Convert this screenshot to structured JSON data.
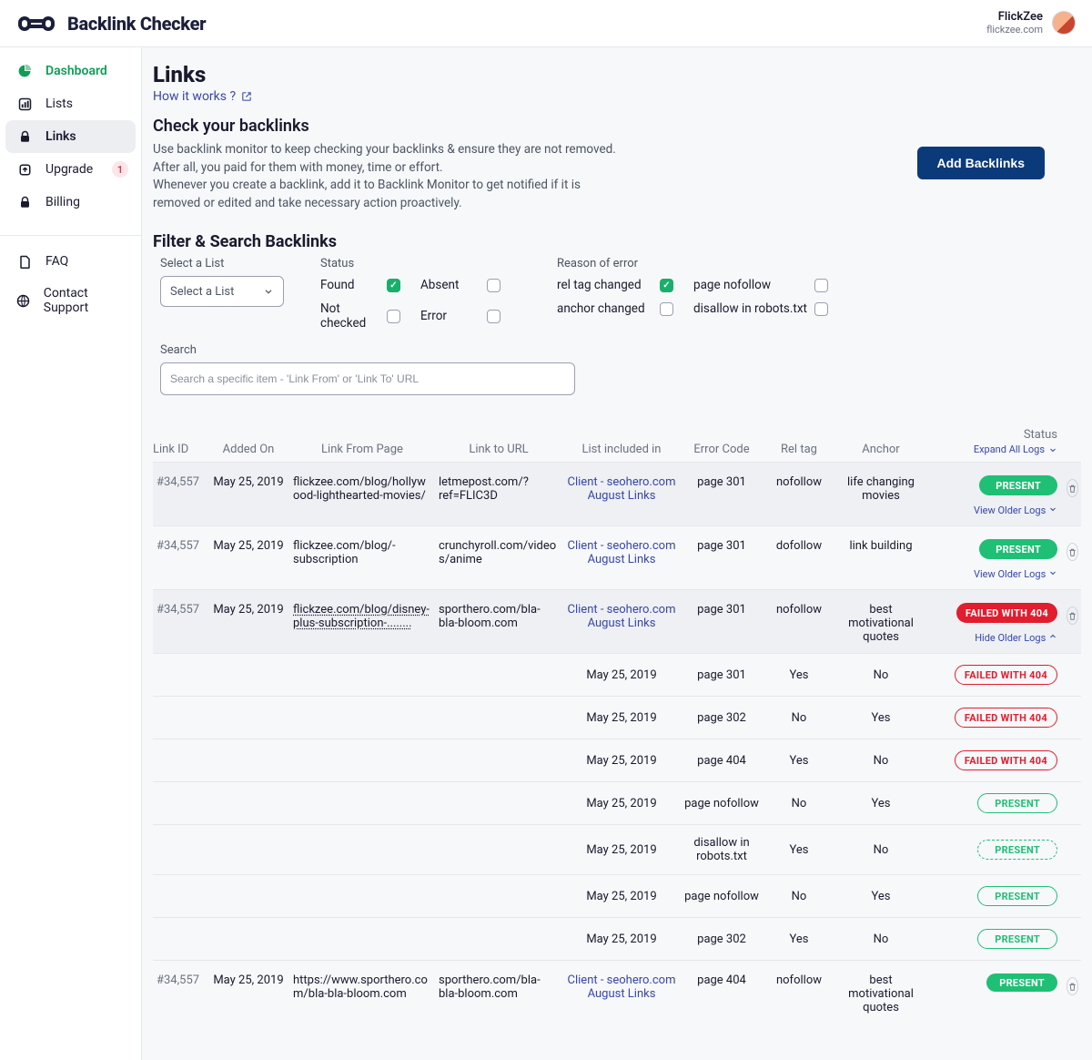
{
  "brand": {
    "name": "Backlink Checker"
  },
  "user": {
    "name": "FlickZee",
    "domain": "flickzee.com"
  },
  "sidebar": {
    "items": [
      {
        "label": "Dashboard"
      },
      {
        "label": "Lists"
      },
      {
        "label": "Links"
      },
      {
        "label": "Upgrade",
        "badge": "1"
      },
      {
        "label": "Billing"
      }
    ],
    "items2": [
      {
        "label": "FAQ"
      },
      {
        "label": "Contact Support"
      }
    ]
  },
  "page": {
    "title": "Links",
    "how_link": "How it works ?",
    "subtitle": "Check your backlinks",
    "intro_l1": "Use backlink monitor to keep checking your backlinks & ensure they are not removed.",
    "intro_l2": "After all, you paid for them with money, time or effort.",
    "intro_l3": "Whenever you create a backlink, add it to Backlink Monitor to get notified if it is removed or edited and take necessary action proactively.",
    "add_btn": "Add Backlinks"
  },
  "filters": {
    "title": "Filter & Search Backlinks",
    "select_list_label": "Select a List",
    "select_list_value": "Select a List",
    "status_label": "Status",
    "status_found": "Found",
    "status_absent": "Absent",
    "status_notchecked": "Not checked",
    "status_error": "Error",
    "reason_label": "Reason of error",
    "reason_rel": "rel tag changed",
    "reason_anchor": "anchor changed",
    "reason_nofollow": "page nofollow",
    "reason_robots": "disallow in robots.txt",
    "search_label": "Search",
    "search_placeholder": "Search a specific item - 'Link From' or 'Link To' URL"
  },
  "table": {
    "headers": {
      "link_id": "Link ID",
      "added_on": "Added On",
      "link_from": "Link From Page",
      "link_to": "Link to URL",
      "list": "List included in",
      "error_code": "Error Code",
      "rel": "Rel tag",
      "anchor": "Anchor",
      "status": "Status",
      "expand_all": "Expand All Logs"
    },
    "view_older": "View Older Logs",
    "hide_older": "Hide  Older Logs",
    "rows": [
      {
        "id": "#34,557",
        "added": "May 25, 2019",
        "from": "flickzee.com/blog/hollywood-lighthearted-movies/",
        "to": "letmepost.com/?ref=FLIC3D",
        "list1": "Client - seohero.com",
        "list2": "August Links",
        "error": "page 301",
        "rel": "nofollow",
        "anchor": "life changing movies",
        "status": "PRESENT",
        "status_style": "solid"
      },
      {
        "id": "#34,557",
        "added": "May 25, 2019",
        "from": "flickzee.com/blog/-subscription",
        "to": "crunchyroll.com/videos/anime",
        "list1": "Client - seohero.com",
        "list2": "August Links",
        "error": "page 301",
        "rel": "dofollow",
        "anchor": "link building",
        "status": "PRESENT",
        "status_style": "solid"
      },
      {
        "id": "#34,557",
        "added": "May 25, 2019",
        "from": "flickzee.com/blog/disney-plus-subscription-........",
        "to": "sporthero.com/bla-bla-bloom.com",
        "list1": "Client - seohero.com",
        "list2": "August Links",
        "error": "page 301",
        "rel": "nofollow",
        "anchor": "best motivational quotes",
        "status": "FAILED WITH 404",
        "status_style": "fail-solid",
        "from_underlined": true,
        "expanded_logs": [
          {
            "date": "May 25, 2019",
            "error": "page 301",
            "rel": "Yes",
            "anchor": "No",
            "status": "FAILED WITH 404",
            "style": "fail-outline"
          },
          {
            "date": "May 25, 2019",
            "error": "page 302",
            "rel": "No",
            "anchor": "Yes",
            "status": "FAILED WITH 404",
            "style": "fail-outline"
          },
          {
            "date": "May 25, 2019",
            "error": "page 404",
            "rel": "Yes",
            "anchor": "No",
            "status": "FAILED WITH 404",
            "style": "fail-outline"
          },
          {
            "date": "May 25, 2019",
            "error": "page nofollow",
            "rel": "No",
            "anchor": "Yes",
            "status": "PRESENT",
            "style": "present-outline"
          },
          {
            "date": "May 25, 2019",
            "error": "disallow in robots.txt",
            "rel": "Yes",
            "anchor": "No",
            "status": "PRESENT",
            "style": "present-dashed"
          },
          {
            "date": "May 25, 2019",
            "error": "page nofollow",
            "rel": "No",
            "anchor": "Yes",
            "status": "PRESENT",
            "style": "present-outline"
          },
          {
            "date": "May 25, 2019",
            "error": "page 302",
            "rel": "Yes",
            "anchor": "No",
            "status": "PRESENT",
            "style": "present-outline"
          }
        ]
      },
      {
        "id": "#34,557",
        "added": "May 25, 2019",
        "from": "https://www.sporthero.com/bla-bla-bloom.com",
        "to": "sporthero.com/bla-bla-bloom.com",
        "list1": "Client - seohero.com",
        "list2": "August Links",
        "error": "page 404",
        "rel": "nofollow",
        "anchor": "best motivational quotes",
        "status": "PRESENT",
        "status_style": "tiny"
      }
    ]
  }
}
